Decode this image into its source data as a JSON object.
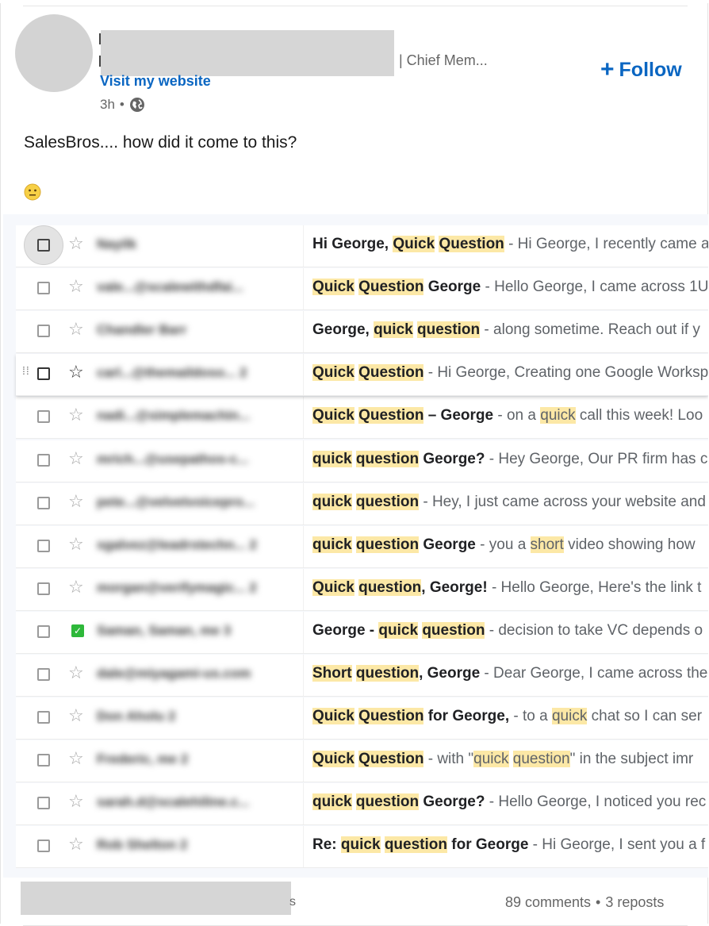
{
  "post": {
    "headline": "| Chief Mem...",
    "visit_link": "Visit my website",
    "time": "3h",
    "separator": "•",
    "follow_label": "Follow",
    "text": "SalesBros.... how did it come to this?",
    "emoji": "😐"
  },
  "inbox": {
    "rows": [
      {
        "sender": "Nayilk",
        "subject": [
          [
            "Hi George, ",
            ""
          ],
          [
            "Quick",
            "hl"
          ],
          [
            " ",
            ""
          ],
          [
            "Question",
            "hl"
          ]
        ],
        "preview": [
          [
            " - Hi George, I recently came a",
            ""
          ]
        ]
      },
      {
        "sender": "vale...@scalewithdfai...",
        "subject": [
          [
            "Quick",
            "hl"
          ],
          [
            " ",
            ""
          ],
          [
            "Question",
            "hl"
          ],
          [
            " George",
            ""
          ]
        ],
        "preview": [
          [
            " - Hello George, I came across 1U",
            ""
          ]
        ]
      },
      {
        "sender": "Chandler Barr",
        "subject": [
          [
            "George, ",
            ""
          ],
          [
            "quick",
            "hl"
          ],
          [
            " ",
            ""
          ],
          [
            "question",
            "hl"
          ]
        ],
        "preview": [
          [
            " - along sometime. Reach out if y",
            ""
          ]
        ]
      },
      {
        "sender": "carl...@themaildoso... 2",
        "subject": [
          [
            "Quick",
            "hl"
          ],
          [
            " ",
            ""
          ],
          [
            "Question",
            "hl"
          ]
        ],
        "preview": [
          [
            " - Hi George, Creating one Google Worksp",
            ""
          ]
        ]
      },
      {
        "sender": "nadi...@simplemachin...",
        "subject": [
          [
            "Quick",
            "hl"
          ],
          [
            " ",
            ""
          ],
          [
            "Question",
            "hl"
          ],
          [
            " – George",
            ""
          ]
        ],
        "preview": [
          [
            " - on a ",
            ""
          ],
          [
            "quick",
            "hl"
          ],
          [
            " call this week! Loo",
            ""
          ]
        ]
      },
      {
        "sender": "mrich...@usepathos-c...",
        "subject": [
          [
            "quick",
            "hl"
          ],
          [
            " ",
            ""
          ],
          [
            "question",
            "hl"
          ],
          [
            " George?",
            ""
          ]
        ],
        "preview": [
          [
            " - Hey George, Our PR firm has c",
            ""
          ]
        ]
      },
      {
        "sender": "pete...@velvetvoicepro...",
        "subject": [
          [
            "quick",
            "hl"
          ],
          [
            " ",
            ""
          ],
          [
            "question",
            "hl"
          ]
        ],
        "preview": [
          [
            " - Hey, I just came across your website and",
            ""
          ]
        ]
      },
      {
        "sender": "sgalvez@leadrstechn... 2",
        "subject": [
          [
            "quick",
            "hl"
          ],
          [
            " ",
            ""
          ],
          [
            "question",
            "hl"
          ],
          [
            " George",
            ""
          ]
        ],
        "preview": [
          [
            " - you a ",
            ""
          ],
          [
            "short",
            "hl"
          ],
          [
            " video showing how",
            ""
          ]
        ]
      },
      {
        "sender": "morgan@verifymagic... 2",
        "subject": [
          [
            "Quick",
            "hl"
          ],
          [
            " ",
            ""
          ],
          [
            "question",
            "hl"
          ],
          [
            ", George!",
            ""
          ]
        ],
        "preview": [
          [
            " - Hello George, Here's the link t",
            ""
          ]
        ]
      },
      {
        "sender": "Saman, Saman, me 3",
        "subject": [
          [
            "George - ",
            ""
          ],
          [
            "quick",
            "hl"
          ],
          [
            " ",
            ""
          ],
          [
            "question",
            "hl"
          ]
        ],
        "preview": [
          [
            " - decision to take VC depends o",
            ""
          ]
        ]
      },
      {
        "sender": "dale@miyagami-us.com",
        "subject": [
          [
            "Short",
            "hl"
          ],
          [
            " ",
            ""
          ],
          [
            "question",
            "hl"
          ],
          [
            ", George",
            ""
          ]
        ],
        "preview": [
          [
            " - Dear George, I came across the",
            ""
          ]
        ]
      },
      {
        "sender": "Don Aholu 2",
        "subject": [
          [
            "Quick",
            "hl"
          ],
          [
            " ",
            ""
          ],
          [
            "Question",
            "hl"
          ],
          [
            " for George,",
            ""
          ]
        ],
        "preview": [
          [
            " - to a ",
            ""
          ],
          [
            "quick",
            "hl"
          ],
          [
            " chat so I can ser",
            ""
          ]
        ]
      },
      {
        "sender": "Frederic, me 2",
        "subject": [
          [
            "Quick",
            "hl"
          ],
          [
            " ",
            ""
          ],
          [
            "Question",
            "hl"
          ]
        ],
        "preview": [
          [
            " - with \"",
            ""
          ],
          [
            "quick",
            "hl"
          ],
          [
            " ",
            ""
          ],
          [
            "question",
            "hl"
          ],
          [
            "\" in the subject imr",
            ""
          ]
        ]
      },
      {
        "sender": "sarah.d@scalehiline.c...",
        "subject": [
          [
            "quick",
            "hl"
          ],
          [
            " ",
            ""
          ],
          [
            "question",
            "hl"
          ],
          [
            " George?",
            ""
          ]
        ],
        "preview": [
          [
            " - Hello George, I noticed you rec",
            ""
          ]
        ]
      },
      {
        "sender": "Rob Shelton 2",
        "subject": [
          [
            "Re: ",
            ""
          ],
          [
            "quick",
            "hl"
          ],
          [
            " ",
            ""
          ],
          [
            "question",
            "hl"
          ],
          [
            " for George",
            ""
          ]
        ],
        "preview": [
          [
            " - Hi George, I sent you a f",
            ""
          ]
        ]
      }
    ]
  },
  "footer": {
    "trailing_char": "s",
    "comments": "89 comments",
    "dot": "•",
    "reposts": "3 reposts"
  },
  "colors": {
    "link_blue": "#0a66c2",
    "highlight": "#fce8a6",
    "redaction_gray": "#d6d6d6",
    "inbox_bg": "#f6f8fc"
  }
}
